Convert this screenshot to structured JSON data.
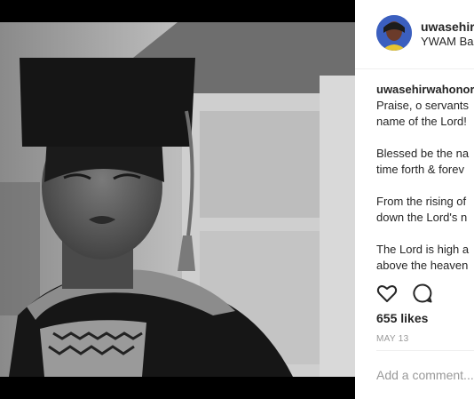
{
  "post": {
    "username": "uwasehirwahonore",
    "location": "YWAM Base"
  },
  "caption": {
    "username": "uwasehirwahonore",
    "lines": [
      "Praise, o servants",
      "name of the Lord!",
      "Blessed be the na",
      "time forth & forev",
      "From the rising of",
      "down the Lord's n",
      "The Lord is high a",
      "above the heaven"
    ]
  },
  "actions": {
    "like_icon": "heart-icon",
    "comment_icon": "comment-icon"
  },
  "likes": "655 likes",
  "date": "MAY 13",
  "comment_placeholder": "Add a comment..."
}
